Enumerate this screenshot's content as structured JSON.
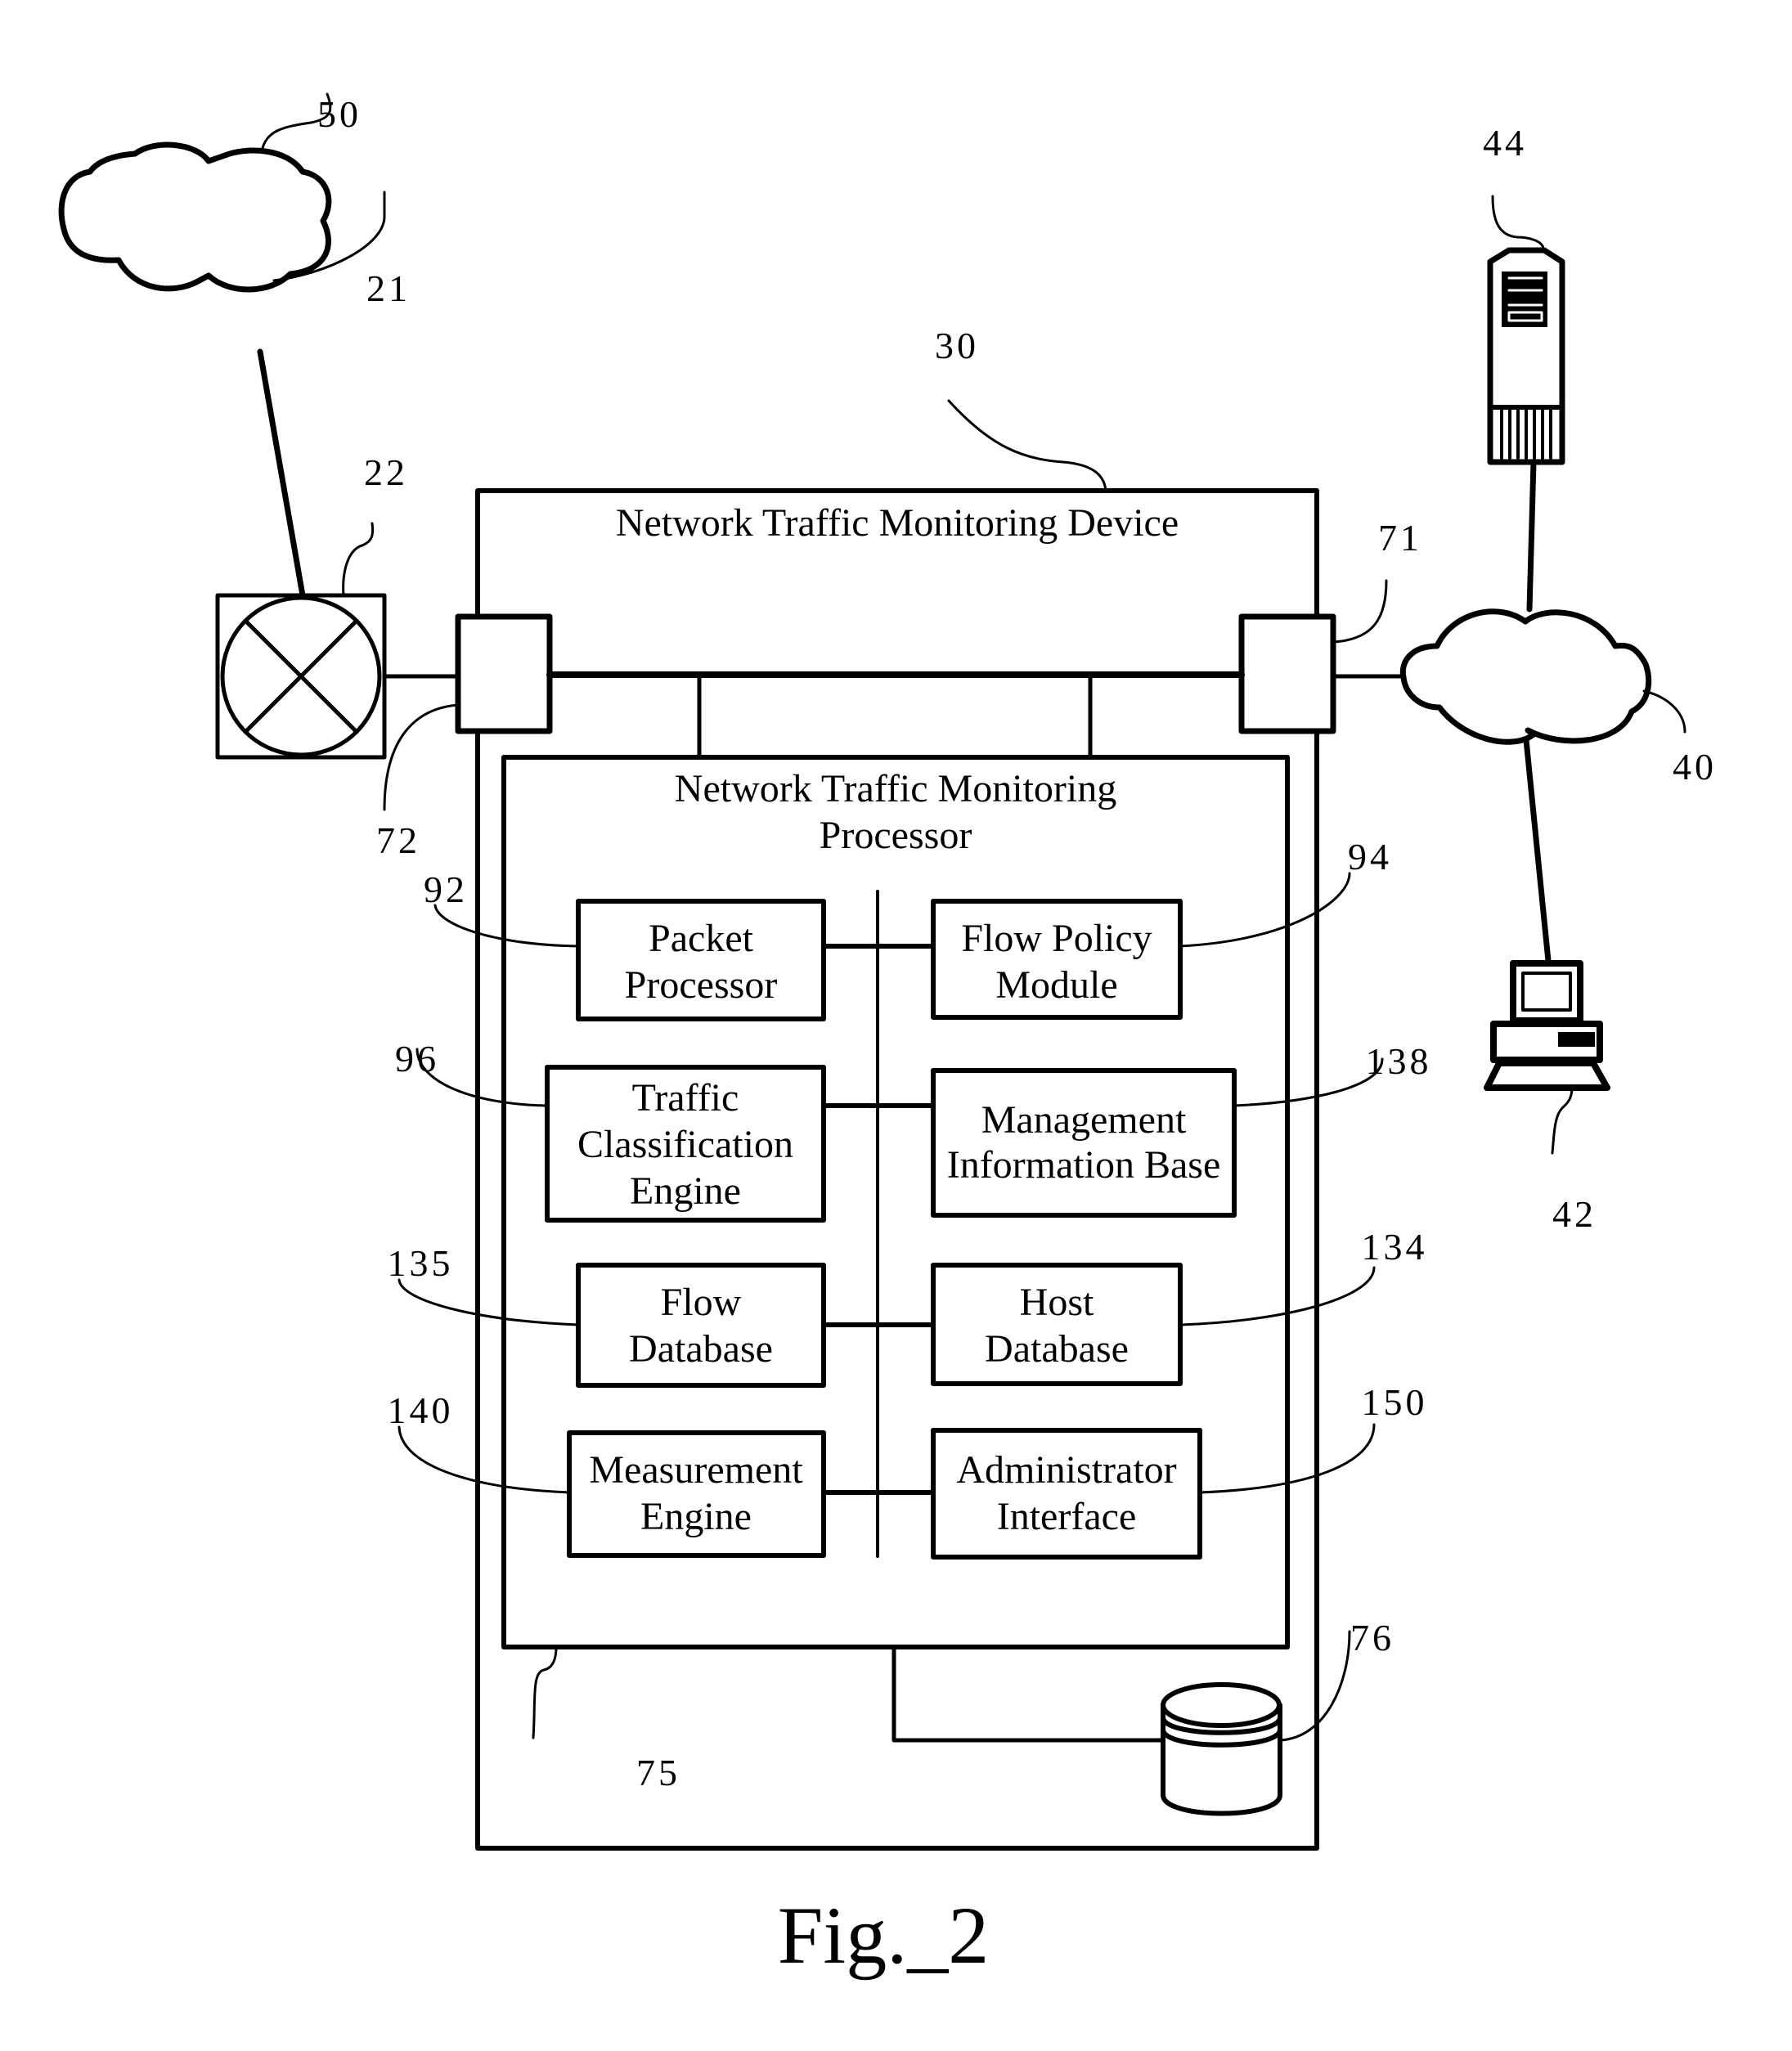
{
  "figure": {
    "caption": "Fig._2",
    "device": {
      "ref": "30",
      "title": "Network Traffic Monitoring Device"
    },
    "processor": {
      "ref": "75",
      "title_line1": "Network Traffic Monitoring",
      "title_line2": "Processor"
    },
    "ports": [
      {
        "ref": "72",
        "side": "left"
      },
      {
        "ref": "71",
        "side": "right"
      }
    ],
    "storage": {
      "ref": "76",
      "icon": "database-cylinder-icon"
    },
    "router": {
      "ref": "22",
      "icon": "router-icon"
    },
    "link": {
      "ref": "21"
    },
    "wan_cloud": {
      "ref": "50",
      "icon": "cloud-icon"
    },
    "lan_cloud": {
      "ref": "40",
      "icon": "cloud-icon"
    },
    "server": {
      "ref": "44",
      "icon": "server-tower-icon"
    },
    "client": {
      "ref": "42",
      "icon": "desktop-computer-icon"
    },
    "modules": [
      {
        "ref": "92",
        "line1": "Packet",
        "line2": "Processor",
        "line3": ""
      },
      {
        "ref": "94",
        "line1": "Flow Policy",
        "line2": "Module",
        "line3": ""
      },
      {
        "ref": "96",
        "line1": "Traffic",
        "line2": "Classification",
        "line3": "Engine"
      },
      {
        "ref": "138",
        "line1": "Management",
        "line2": "Information Base",
        "line3": ""
      },
      {
        "ref": "135",
        "line1": "Flow",
        "line2": "Database",
        "line3": ""
      },
      {
        "ref": "134",
        "line1": "Host",
        "line2": "Database",
        "line3": ""
      },
      {
        "ref": "140",
        "line1": "Measurement",
        "line2": "Engine",
        "line3": ""
      },
      {
        "ref": "150",
        "line1": "Administrator",
        "line2": "Interface",
        "line3": ""
      }
    ]
  }
}
